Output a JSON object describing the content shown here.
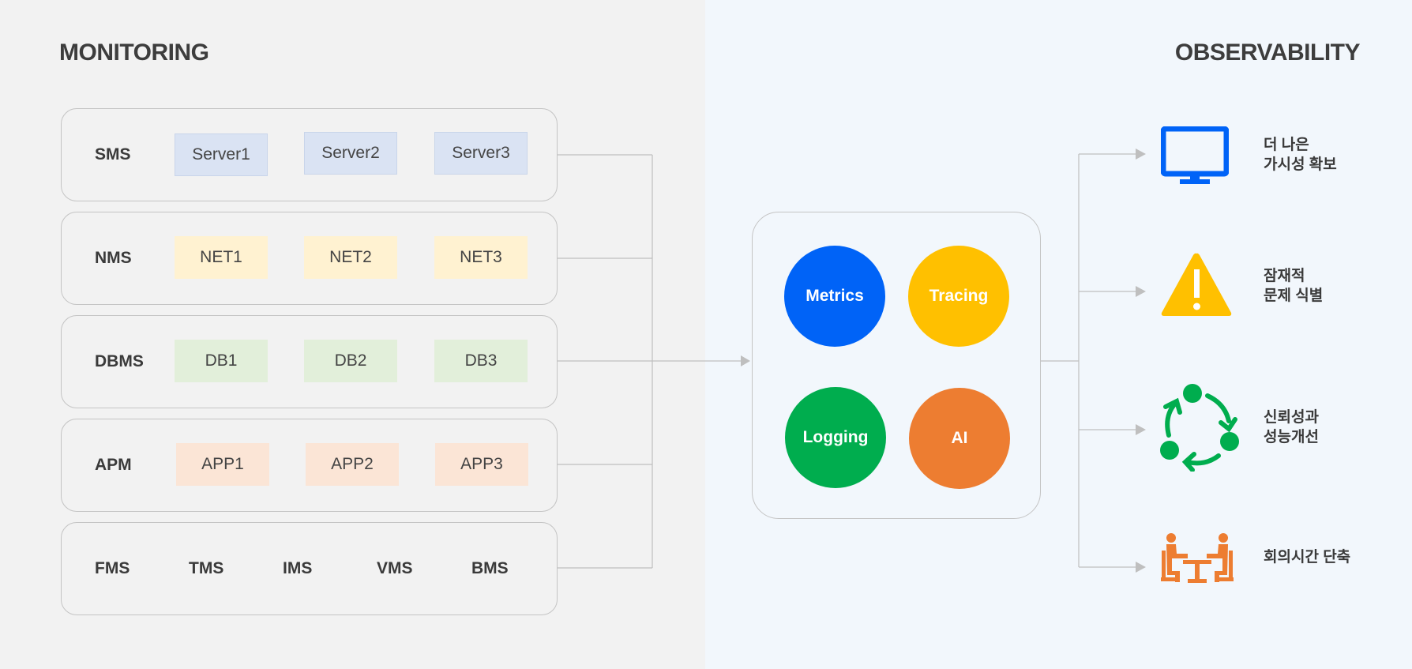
{
  "titles": {
    "left": "MONITORING",
    "right": "OBSERVABILITY"
  },
  "rows": [
    {
      "label": "SMS",
      "chips": [
        "Server1",
        "Server2",
        "Server3"
      ],
      "chip_color": "#dae3f3",
      "chip_border": "#c9d5ea"
    },
    {
      "label": "NMS",
      "chips": [
        "NET1",
        "NET2",
        "NET3"
      ],
      "chip_color": "#fff2d1",
      "chip_border": "#fff2d1"
    },
    {
      "label": "DBMS",
      "chips": [
        "DB1",
        "DB2",
        "DB3"
      ],
      "chip_color": "#e2efda",
      "chip_border": "#e2efda"
    },
    {
      "label": "APM",
      "chips": [
        "APP1",
        "APP2",
        "APP3"
      ],
      "chip_color": "#fbe5d6",
      "chip_border": "#fbe5d6"
    }
  ],
  "other_systems": [
    "FMS",
    "TMS",
    "IMS",
    "VMS",
    "BMS"
  ],
  "pillars": [
    {
      "label": "Metrics",
      "color": "#0063f7"
    },
    {
      "label": "Tracing",
      "color": "#ffc000"
    },
    {
      "label": "Logging",
      "color": "#00ad4e"
    },
    {
      "label": "AI",
      "color": "#ed7d31"
    }
  ],
  "benefits": [
    {
      "icon": "monitor-icon",
      "line1": "더 나은",
      "line2": "가시성 확보",
      "color": "#0063f7"
    },
    {
      "icon": "warning-icon",
      "line1": "잠재적",
      "line2": "문제 식별",
      "color": "#ffc000"
    },
    {
      "icon": "cycle-icon",
      "line1": "신뢰성과",
      "line2": "성능개선",
      "color": "#00ad4e"
    },
    {
      "icon": "meeting-icon",
      "line1": "회의시간 단축",
      "line2": "",
      "color": "#ed7d31"
    }
  ],
  "colors": {
    "connector": "#bfbfbf",
    "text": "#3a3a3a"
  }
}
